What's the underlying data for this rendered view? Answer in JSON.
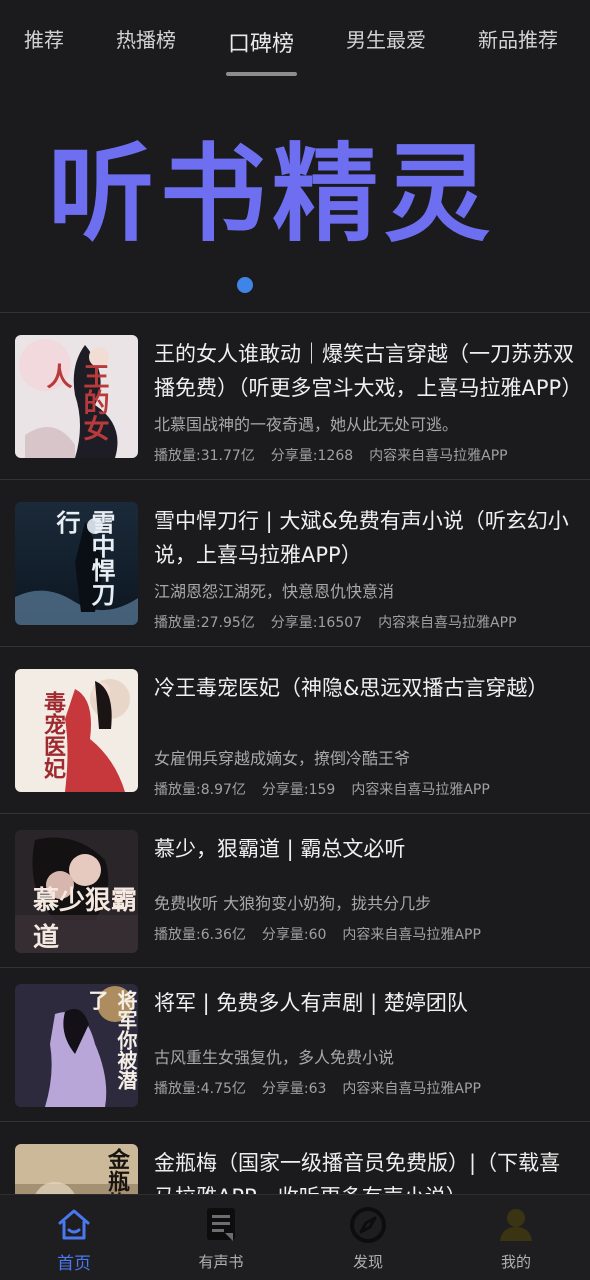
{
  "tabs": [
    {
      "label": "推荐"
    },
    {
      "label": "热播榜"
    },
    {
      "label": "口碑榜"
    },
    {
      "label": "男生最爱"
    },
    {
      "label": "新品推荐"
    }
  ],
  "active_tab": "口碑榜",
  "banner": {
    "text": "听书精灵"
  },
  "items": [
    {
      "title": "王的女人谁敢动｜爆笑古言穿越（一刀苏苏双播免费）（听更多宫斗大戏，上喜马拉雅APP）",
      "desc": "北慕国战神的一夜奇遇，她从此无处可逃。",
      "plays": "播放量:31.77亿",
      "shares": "分享量:1268",
      "source": "内容来自喜马拉雅APP",
      "cover_text": "王的女人"
    },
    {
      "title": "雪中悍刀行 | 大斌&免费有声小说（听玄幻小说，上喜马拉雅APP）",
      "desc": "江湖恩怨江湖死，快意恩仇快意消",
      "plays": "播放量:27.95亿",
      "shares": "分享量:16507",
      "source": "内容来自喜马拉雅APP",
      "cover_text": "雪中悍刀行"
    },
    {
      "title": "冷王毒宠医妃（神隐&思远双播古言穿越）",
      "desc": "女雇佣兵穿越成嫡女，撩倒冷酷王爷",
      "plays": "播放量:8.97亿",
      "shares": "分享量:159",
      "source": "内容来自喜马拉雅APP",
      "cover_text": "毒宠医妃"
    },
    {
      "title": "慕少，狠霸道 | 霸总文必听",
      "desc": "免费收听 大狼狗变小奶狗，拢共分几步",
      "plays": "播放量:6.36亿",
      "shares": "分享量:60",
      "source": "内容来自喜马拉雅APP",
      "cover_text": "慕少狠霸道"
    },
    {
      "title": "将军 | 免费多人有声剧 | 楚婷团队",
      "desc": "古风重生女强复仇，多人免费小说",
      "plays": "播放量:4.75亿",
      "shares": "分享量:63",
      "source": "内容来自喜马拉雅APP",
      "cover_text": "将军你被潜了"
    },
    {
      "title": "金瓶梅（国家一级播音员免费版）|（下载喜马拉雅APP，收听更多有声小说）",
      "desc": "",
      "plays": "",
      "shares": "",
      "source": "",
      "cover_text": "金瓶梅"
    }
  ],
  "bottom_nav": [
    {
      "label": "首页",
      "icon": "home-icon",
      "active": true
    },
    {
      "label": "有声书",
      "icon": "audiobook-icon",
      "active": false
    },
    {
      "label": "发现",
      "icon": "compass-icon",
      "active": false
    },
    {
      "label": "我的",
      "icon": "user-icon",
      "active": false
    }
  ],
  "colors": {
    "background": "#1b1b1d",
    "banner_text": "#6e6ff0",
    "accent": "#4a78f0",
    "dot": "#3f85e8"
  }
}
